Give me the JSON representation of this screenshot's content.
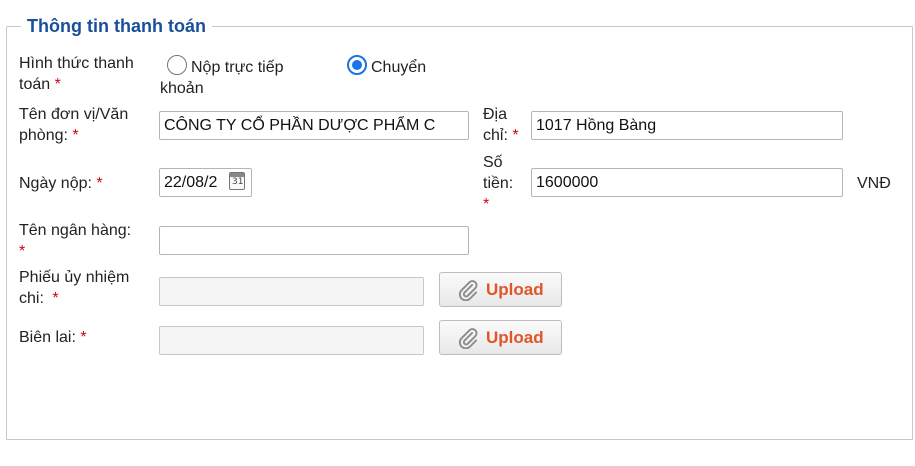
{
  "section": {
    "title": "Thông tin thanh toán"
  },
  "payment_method": {
    "label_line1": "Hình thức thanh",
    "label_line2": "toán",
    "required": "*",
    "options": [
      {
        "label_line1": "Nộp trực tiếp",
        "label_line2": "",
        "checked": false
      },
      {
        "label_line1": "Chuyển",
        "label_line2": "khoản",
        "checked": true
      }
    ]
  },
  "unit": {
    "label_line1": "Tên đơn vị/Văn",
    "label_line2": "phòng:",
    "required": "*",
    "value": "CÔNG TY CỔ PHẦN DƯỢC PHẨM C"
  },
  "address": {
    "label_line1": "Địa",
    "label_line2": "chỉ:",
    "required": "*",
    "value": "1017 Hồng Bàng"
  },
  "date": {
    "label": "Ngày nộp:",
    "required": "*",
    "value": "22/08/2",
    "calendar_icon_text": "31"
  },
  "amount": {
    "label_line1": "Số",
    "label_line2": "tiền:",
    "required": "*",
    "value": "1600000",
    "currency": "VNĐ"
  },
  "bank": {
    "label": "Tên ngân hàng:",
    "required": "*",
    "value": ""
  },
  "payment_order": {
    "label_line1": "Phiếu ủy nhiệm",
    "label_line2": "chi:",
    "required": "*",
    "upload_label": "Upload",
    "icon": "paperclip-icon"
  },
  "receipt": {
    "label": "Biên lai:",
    "required": "*",
    "upload_label": "Upload",
    "icon": "paperclip-icon"
  },
  "colors": {
    "legend": "#1a4f9c",
    "required": "#d0021b",
    "upload_text": "#e0552b",
    "radio_checked": "#1a73e8"
  }
}
